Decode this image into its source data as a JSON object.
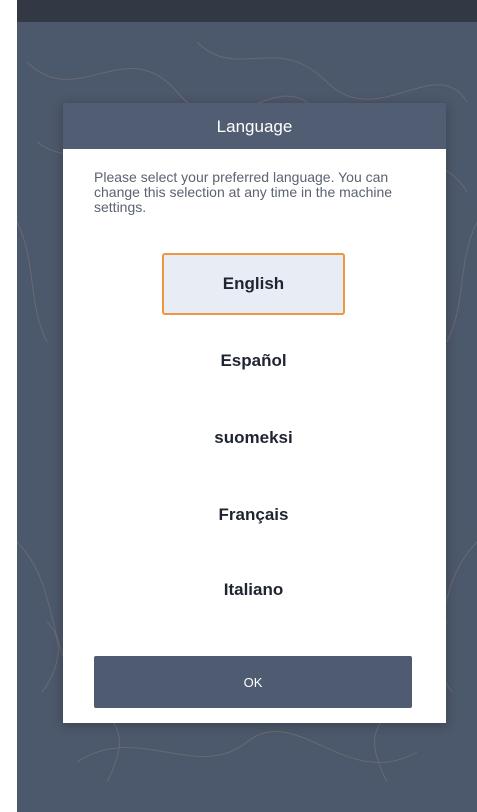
{
  "colors": {
    "background": "#4c586b",
    "header": "#505d72",
    "selected_fill": "#e8edf5",
    "selected_border": "#ef9740",
    "button": "#4f5b70"
  },
  "dialog": {
    "title": "Language",
    "message": "Please select your preferred language. You can change this selection at any time in the machine settings.",
    "languages": [
      {
        "label": "English",
        "selected": true
      },
      {
        "label": "Español",
        "selected": false
      },
      {
        "label": "suomeksi",
        "selected": false
      },
      {
        "label": "Français",
        "selected": false
      },
      {
        "label": "Italiano",
        "selected": false
      }
    ],
    "ok_label": "OK"
  }
}
